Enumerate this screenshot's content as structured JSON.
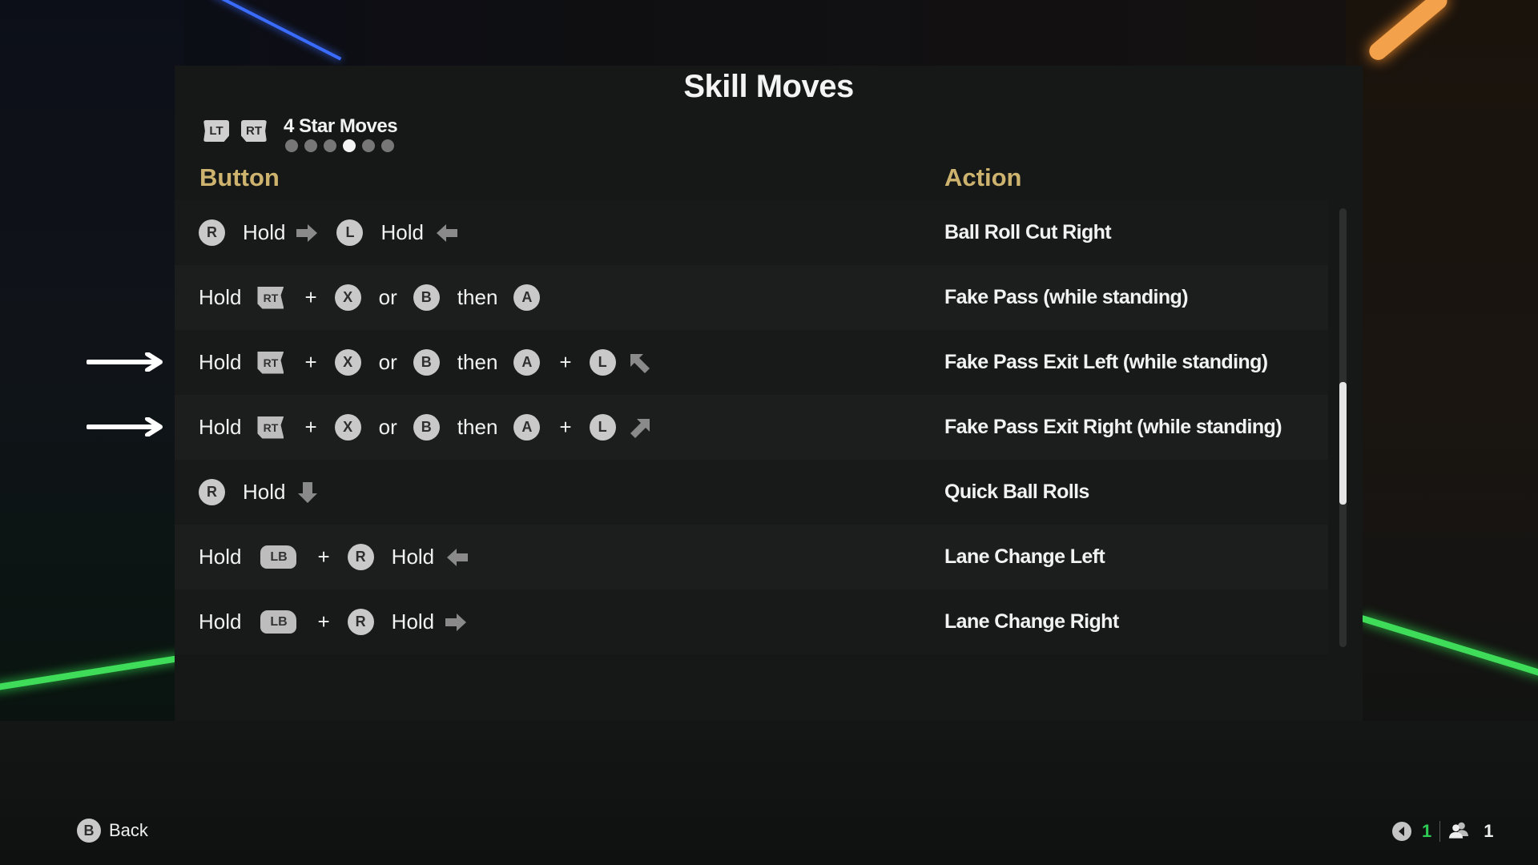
{
  "screen": {
    "title": "Skill Moves",
    "tabs": {
      "prev_trigger": "LT",
      "next_trigger": "RT",
      "current_label": "4 Star Moves",
      "page_count": 6,
      "active_page": 4
    },
    "columns": {
      "button": "Button",
      "action": "Action"
    },
    "rows": [
      {
        "combo": [
          {
            "type": "circle",
            "label": "R"
          },
          {
            "type": "text",
            "label": "Hold"
          },
          {
            "type": "arrow",
            "dir": "right"
          },
          {
            "type": "circle",
            "label": "L"
          },
          {
            "type": "text",
            "label": "Hold"
          },
          {
            "type": "arrow",
            "dir": "left"
          }
        ],
        "action": "Ball Roll Cut Right",
        "highlighted": false
      },
      {
        "combo": [
          {
            "type": "text",
            "label": "Hold"
          },
          {
            "type": "trigger",
            "label": "RT"
          },
          {
            "type": "plus",
            "label": "+"
          },
          {
            "type": "circle",
            "label": "X"
          },
          {
            "type": "text",
            "label": "or"
          },
          {
            "type": "circle",
            "label": "B"
          },
          {
            "type": "text",
            "label": "then"
          },
          {
            "type": "circle",
            "label": "A"
          }
        ],
        "action": "Fake Pass (while standing)",
        "highlighted": false
      },
      {
        "combo": [
          {
            "type": "text",
            "label": "Hold"
          },
          {
            "type": "trigger",
            "label": "RT"
          },
          {
            "type": "plus",
            "label": "+"
          },
          {
            "type": "circle",
            "label": "X"
          },
          {
            "type": "text",
            "label": "or"
          },
          {
            "type": "circle",
            "label": "B"
          },
          {
            "type": "text",
            "label": "then"
          },
          {
            "type": "circle",
            "label": "A"
          },
          {
            "type": "plus",
            "label": "+"
          },
          {
            "type": "circle",
            "label": "L"
          },
          {
            "type": "arrow",
            "dir": "up-left"
          }
        ],
        "action": "Fake Pass Exit Left (while standing)",
        "highlighted": true
      },
      {
        "combo": [
          {
            "type": "text",
            "label": "Hold"
          },
          {
            "type": "trigger",
            "label": "RT"
          },
          {
            "type": "plus",
            "label": "+"
          },
          {
            "type": "circle",
            "label": "X"
          },
          {
            "type": "text",
            "label": "or"
          },
          {
            "type": "circle",
            "label": "B"
          },
          {
            "type": "text",
            "label": "then"
          },
          {
            "type": "circle",
            "label": "A"
          },
          {
            "type": "plus",
            "label": "+"
          },
          {
            "type": "circle",
            "label": "L"
          },
          {
            "type": "arrow",
            "dir": "up-right"
          }
        ],
        "action": "Fake Pass Exit Right (while standing)",
        "highlighted": true
      },
      {
        "combo": [
          {
            "type": "circle",
            "label": "R"
          },
          {
            "type": "text",
            "label": "Hold"
          },
          {
            "type": "arrow",
            "dir": "down"
          }
        ],
        "action": "Quick Ball Rolls",
        "highlighted": false
      },
      {
        "combo": [
          {
            "type": "text",
            "label": "Hold"
          },
          {
            "type": "bumper",
            "label": "LB"
          },
          {
            "type": "plus",
            "label": "+"
          },
          {
            "type": "circle",
            "label": "R"
          },
          {
            "type": "text",
            "label": "Hold"
          },
          {
            "type": "arrow",
            "dir": "left"
          }
        ],
        "action": "Lane Change Left",
        "highlighted": false
      },
      {
        "combo": [
          {
            "type": "text",
            "label": "Hold"
          },
          {
            "type": "bumper",
            "label": "LB"
          },
          {
            "type": "plus",
            "label": "+"
          },
          {
            "type": "circle",
            "label": "R"
          },
          {
            "type": "text",
            "label": "Hold"
          },
          {
            "type": "arrow",
            "dir": "right"
          }
        ],
        "action": "Lane Change Right",
        "highlighted": false
      }
    ],
    "scroll": {
      "visible_fraction": 0.28,
      "position_fraction": 0.55
    }
  },
  "footer": {
    "back": {
      "button": "B",
      "label": "Back"
    },
    "status": {
      "voice_icon": "speaker-icon",
      "voice_count": "1",
      "players_icon": "players-icon",
      "players_count": "1"
    }
  },
  "colors": {
    "accent_gold": "#cdb36e",
    "online_green": "#2ecc55"
  }
}
